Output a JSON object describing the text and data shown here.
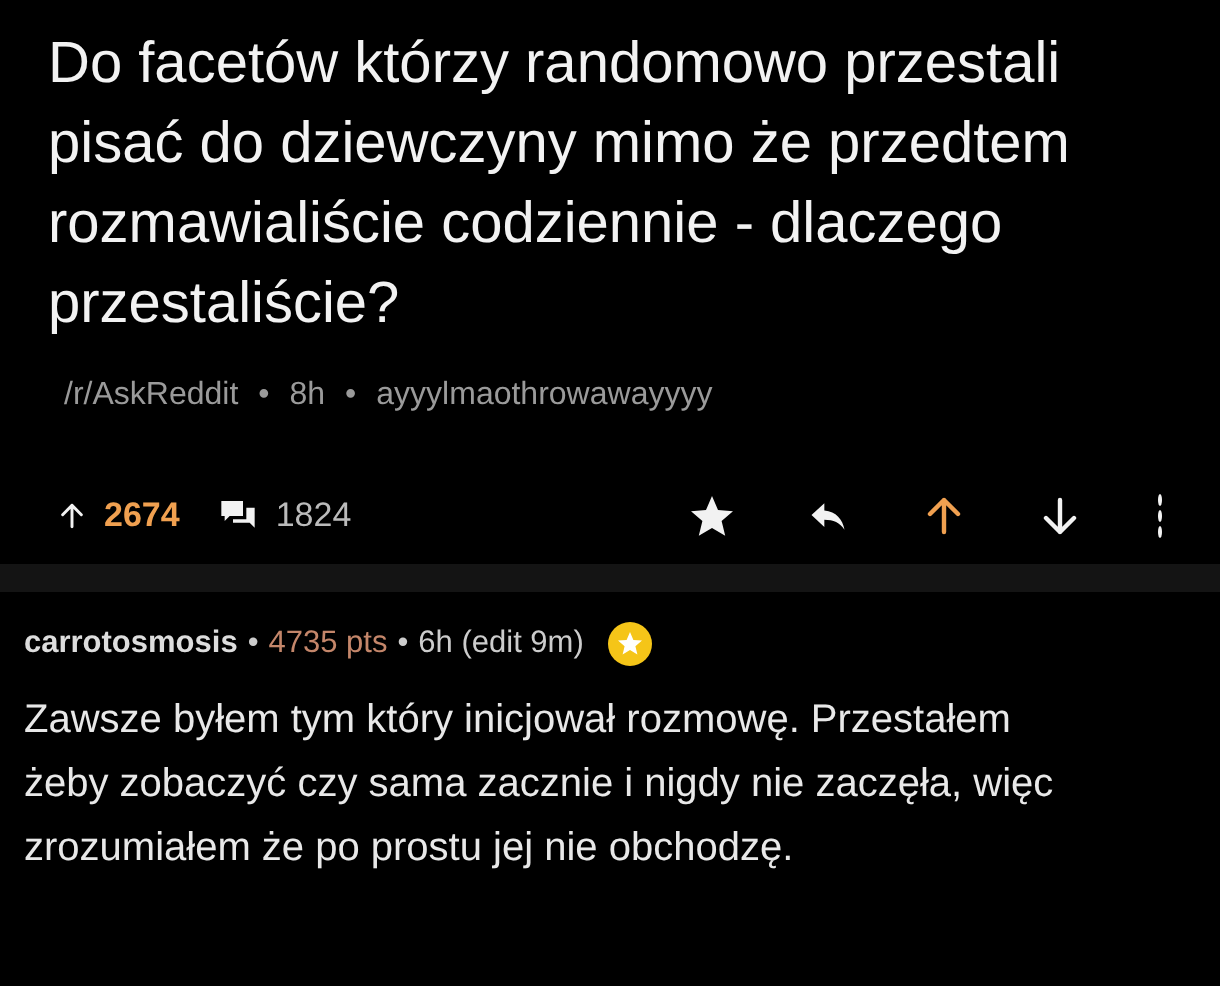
{
  "post": {
    "title": "Do facetów którzy randomowo przestali pisać do dziewczyny mimo że przedtem rozmawialiście codziennie - dlaczego przestaliście?",
    "subreddit": "/r/AskReddit",
    "separator": "•",
    "age": "8h",
    "author": "ayyylmaothrowawayyyy",
    "score": "2674",
    "comments_count": "1824",
    "upvoted": true,
    "downvoted": false
  },
  "comment": {
    "author": "carrotosmosis",
    "separator": "•",
    "points": "4735 pts",
    "age": "6h (edit 9m)",
    "gilded": true,
    "body": "Zawsze byłem tym który inicjował rozmowę. Przestałem żeby zobaczyć czy sama zacznie i nigdy nie zaczęła, więc zrozumiałem że po prostu jej nie obchodzę."
  }
}
